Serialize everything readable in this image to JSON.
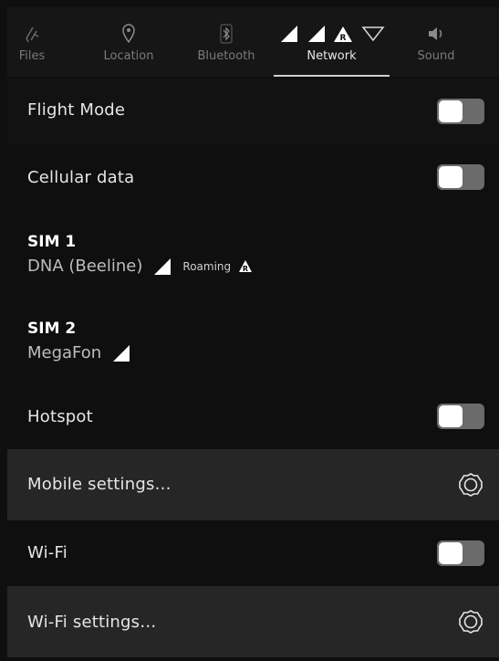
{
  "tabs": [
    {
      "label": "Files",
      "icon": "files-icon"
    },
    {
      "label": "Location",
      "icon": "location-pin-icon"
    },
    {
      "label": "Bluetooth",
      "icon": "bluetooth-icon"
    },
    {
      "label": "Network",
      "icon": "network-signal-icon",
      "active": true
    },
    {
      "label": "Sound",
      "icon": "speaker-icon"
    }
  ],
  "flight_mode": {
    "label": "Flight Mode",
    "enabled": false
  },
  "cellular_data": {
    "label": "Cellular data",
    "enabled": false
  },
  "sim1": {
    "title": "SIM 1",
    "carrier": "DNA (Beeline)",
    "roaming_label": "Roaming"
  },
  "sim2": {
    "title": "SIM 2",
    "carrier": "MegaFon"
  },
  "hotspot": {
    "label": "Hotspot",
    "enabled": false
  },
  "mobile_settings": {
    "label": "Mobile settings…"
  },
  "wifi": {
    "label": "Wi-Fi",
    "enabled": false
  },
  "wifi_settings": {
    "label": "Wi-Fi settings…"
  },
  "colors": {
    "background": "#0f0f0f",
    "highlight_row": "#262626",
    "toggle_off": "#6b6b6b"
  }
}
